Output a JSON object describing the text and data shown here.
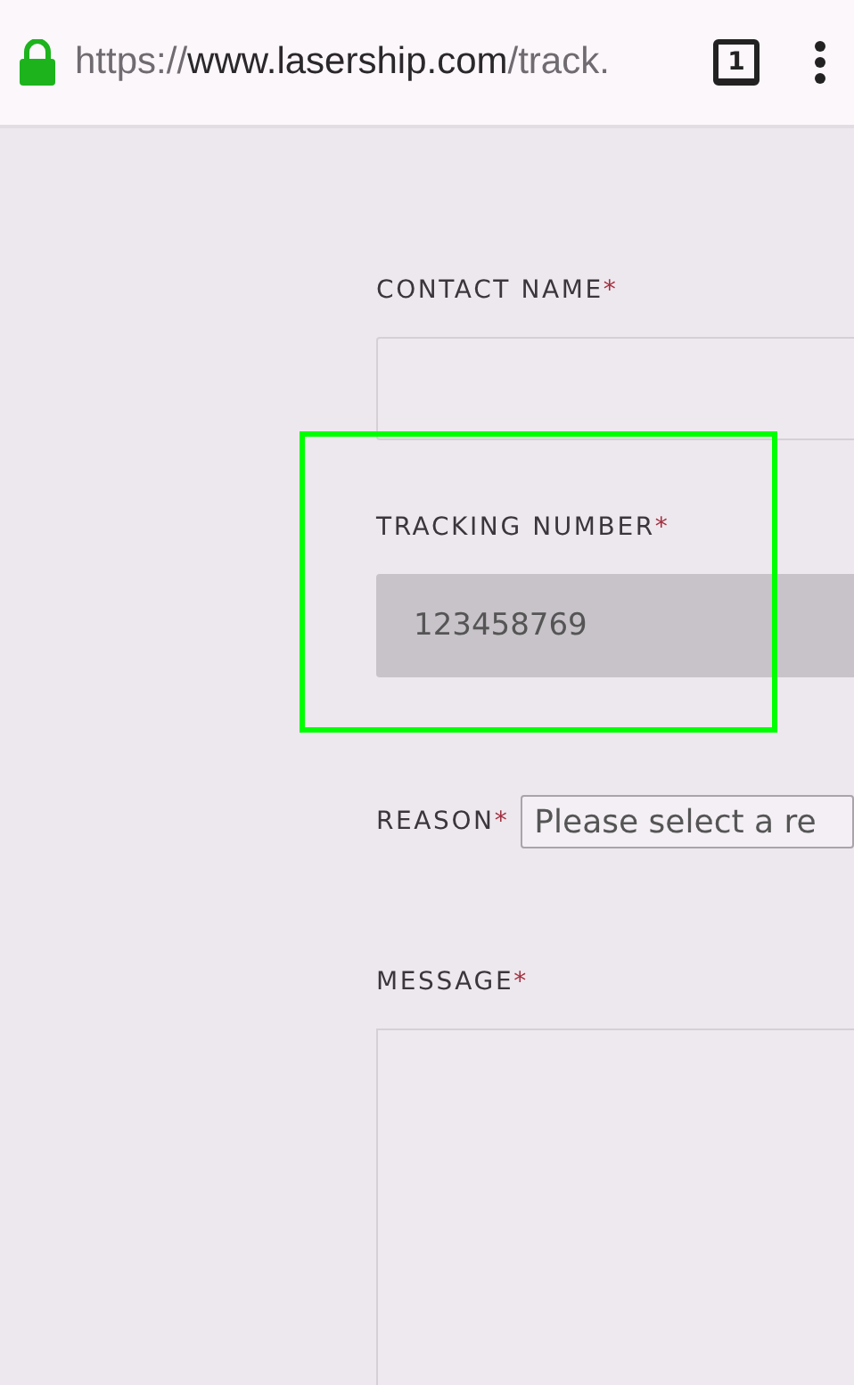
{
  "browser": {
    "secure": true,
    "url_scheme": "https://",
    "url_host": "www.lasership.com",
    "url_path": "/track.",
    "tab_count": "1"
  },
  "form": {
    "fields": [
      {
        "kind": "text",
        "label": "CONTACT NAME",
        "required_mark": "*",
        "disabled": false
      },
      {
        "kind": "text",
        "label": "TRACKING NUMBER",
        "required_mark": "*",
        "value": "123458769",
        "disabled": true,
        "highlighted": true
      },
      {
        "kind": "select",
        "label": "REASON",
        "required_mark": "*",
        "placeholder": "Please select a re"
      },
      {
        "kind": "textarea",
        "label": "MESSAGE",
        "required_mark": "*"
      }
    ]
  }
}
